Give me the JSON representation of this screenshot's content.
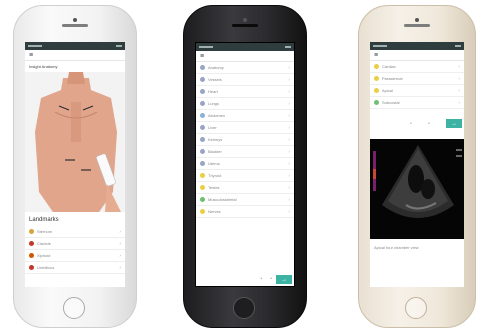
{
  "phone1": {
    "finish": "silver",
    "screen_title": "Insight Anatomy",
    "section_heading": "Landmarks",
    "list_items": [
      {
        "label": "Sternum",
        "dot": "#d9a23a"
      },
      {
        "label": "Clavicle",
        "dot": "#c0392b"
      },
      {
        "label": "Xiphoid",
        "dot": "#d35400"
      },
      {
        "label": "Umbilicus",
        "dot": "#c0392b"
      }
    ],
    "icons": [
      "menu-icon",
      "back-icon",
      "chevron-right-icon"
    ]
  },
  "phone2": {
    "finish": "space-gray",
    "list_items": [
      {
        "label": "Anatomy",
        "dot": "#9aa4c7"
      },
      {
        "label": "Vessels",
        "dot": "#9aa4c7"
      },
      {
        "label": "Heart",
        "dot": "#9aa4c7"
      },
      {
        "label": "Lungs",
        "dot": "#9aa4c7"
      },
      {
        "label": "Abdomen",
        "dot": "#8bb0d6"
      },
      {
        "label": "Liver",
        "dot": "#9aa4c7"
      },
      {
        "label": "Kidneys",
        "dot": "#9aa4c7"
      },
      {
        "label": "Bladder",
        "dot": "#9aa4c7"
      },
      {
        "label": "Uterus",
        "dot": "#9aa4c7"
      },
      {
        "label": "Thyroid",
        "dot": "#e8cf43"
      },
      {
        "label": "Testes",
        "dot": "#e8cf43"
      },
      {
        "label": "Musculoskeletal",
        "dot": "#6fbf73"
      },
      {
        "label": "Nerves",
        "dot": "#e8cf43"
      }
    ],
    "fab_icon": "arrow-right-icon"
  },
  "phone3": {
    "finish": "gold",
    "list_items": [
      {
        "label": "Cardiac",
        "dot": "#e8cf43"
      },
      {
        "label": "Parasternal",
        "dot": "#e8cf43"
      },
      {
        "label": "Apical",
        "dot": "#e8cf43"
      },
      {
        "label": "Subcostal",
        "dot": "#6fbf73"
      }
    ],
    "scan_caption": "Apical four chamber view",
    "fab_icon": "arrow-right-icon"
  },
  "colors": {
    "accent": "#3db3a4",
    "status_bar": "#2f3d3f"
  }
}
